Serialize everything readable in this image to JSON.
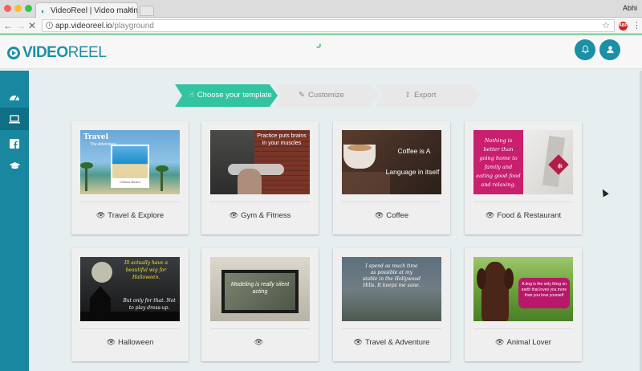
{
  "browser": {
    "tab_title": "VideoReel | Video making app",
    "tab_close": "×",
    "user_name": "Abhi",
    "url_domain": "app.videoreel.io",
    "url_path": "/playground",
    "info_glyph": "i",
    "star_glyph": "☆",
    "abp_label": "ABP",
    "menu_glyph": "⋮"
  },
  "header": {
    "logo_video": "VIDEO",
    "logo_reel": "REEL",
    "bell_glyph": "🔔",
    "user_glyph": "👤"
  },
  "sidebar": {
    "icons": [
      "dashboard-icon",
      "laptop-icon",
      "facebook-icon",
      "graduation-cap-icon"
    ]
  },
  "steps": {
    "items": [
      {
        "label": "Choose your template",
        "icon": "☝",
        "state": "active"
      },
      {
        "label": "Customize",
        "icon": "✎",
        "state": "inactive"
      },
      {
        "label": "Export",
        "icon": "⇪",
        "state": "inactive"
      }
    ]
  },
  "templates": [
    {
      "label": "Travel & Explore",
      "thumb_title": "Travel",
      "thumb_sub": "The Adventure",
      "thumb_caption": "Chillout Beach"
    },
    {
      "label": "Gym & Fitness",
      "thumb_text": "Practice puts brains in your muscles"
    },
    {
      "label": "Coffee",
      "thumb_text_1": "Coffee is A",
      "thumb_text_2": "Language in itself"
    },
    {
      "label": "Food & Restaurant",
      "thumb_text": "Nothing is better than going home to family and eating good food and relaxing."
    },
    {
      "label": "Halloween",
      "thumb_text_1": "Ill actually have a beautiful wig for Halloween.",
      "thumb_text_2": "But only for that. Not to play dress-up."
    },
    {
      "label": "",
      "thumb_text": "Modeling is really silent acting"
    },
    {
      "label": "Travel & Adventure",
      "thumb_text": "I spend as much time as possible at my stable in the Hollywood Hills. It keeps me sane."
    },
    {
      "label": "Animal Lover",
      "thumb_text": "A dog is the only thing on earth that loves you more than you love yourself"
    }
  ],
  "eye_glyph": "👁",
  "colors": {
    "brand": "#1a8fa5",
    "step_active": "#32c4a0",
    "sidebar": "#1a87a1"
  }
}
